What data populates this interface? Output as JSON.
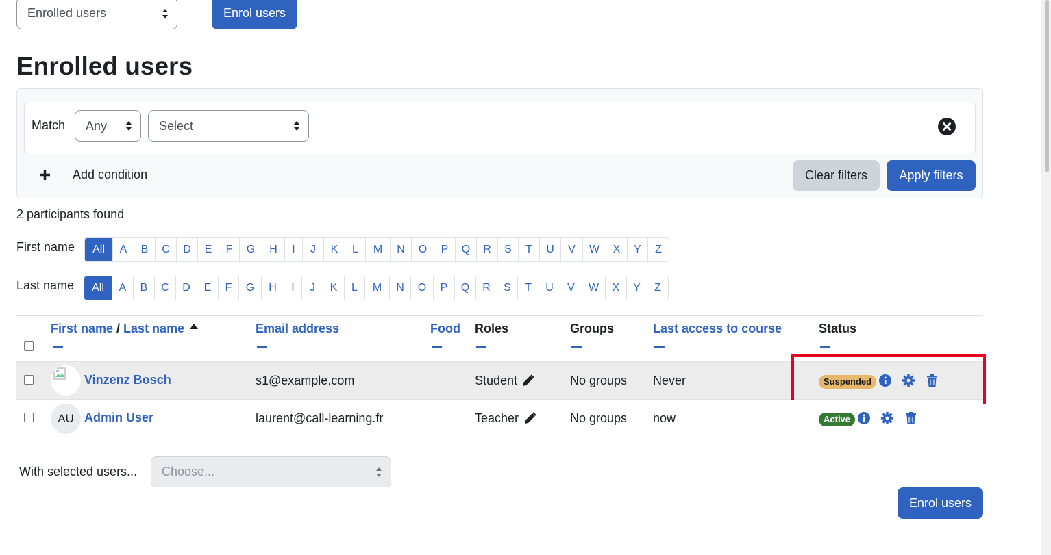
{
  "top": {
    "enrol_method_select": "Enrolled users",
    "enrol_button": "Enrol users"
  },
  "page_title": "Enrolled users",
  "filters": {
    "match_label": "Match",
    "match_value": "Any",
    "condition_select": "Select",
    "add_condition": "Add condition",
    "clear_button": "Clear filters",
    "apply_button": "Apply filters"
  },
  "participants_found": "2 participants found",
  "initials": {
    "first_label": "First name",
    "last_label": "Last name",
    "letters": [
      "All",
      "A",
      "B",
      "C",
      "D",
      "E",
      "F",
      "G",
      "H",
      "I",
      "J",
      "K",
      "L",
      "M",
      "N",
      "O",
      "P",
      "Q",
      "R",
      "S",
      "T",
      "U",
      "V",
      "W",
      "X",
      "Y",
      "Z"
    ]
  },
  "table": {
    "headers": {
      "first_name": "First name",
      "separator": " / ",
      "last_name": "Last name",
      "email": "Email address",
      "food": "Food",
      "roles": "Roles",
      "groups": "Groups",
      "last_access": "Last access to course",
      "status": "Status"
    },
    "rows": [
      {
        "name": "Vinzenz Bosch",
        "avatar": "",
        "email": "s1@example.com",
        "food": "",
        "role": "Student",
        "groups": "No groups",
        "last_access": "Never",
        "status": "Suspended"
      },
      {
        "name": "Admin User",
        "avatar": "AU",
        "email": "laurent@call-learning.fr",
        "food": "",
        "role": "Teacher",
        "groups": "No groups",
        "last_access": "now",
        "status": "Active"
      }
    ]
  },
  "bulk": {
    "label": "With selected users...",
    "placeholder": "Choose..."
  },
  "bottom_enrol_button": "Enrol users",
  "colors": {
    "primary": "#3063c0",
    "suspended_badge": "#f0ad4e",
    "active_badge": "#357a32",
    "highlight_box": "#e8001c"
  }
}
